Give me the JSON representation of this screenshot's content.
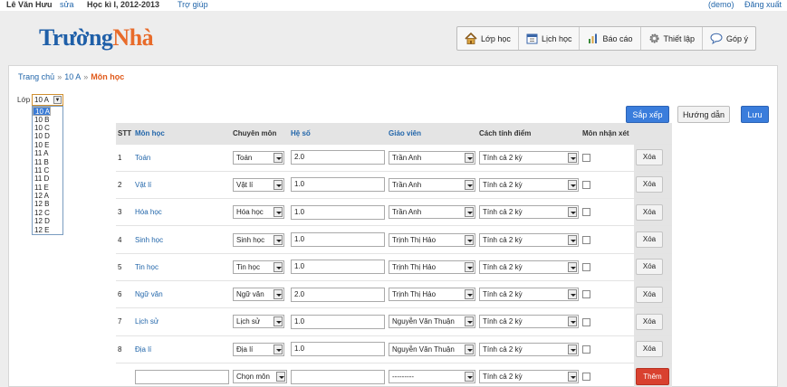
{
  "topbar": {
    "user": "Lê Văn Hưu",
    "edit": "sửa",
    "term": "Học kì I, 2012-2013",
    "help": "Trợ giúp",
    "demo": "(demo)",
    "logout": "Đăng xuất"
  },
  "logo": {
    "part1": "Trường",
    "part2": "Nhà"
  },
  "menu": [
    {
      "label": "Lớp học",
      "icon": "home-icon"
    },
    {
      "label": "Lịch học",
      "icon": "calendar-icon"
    },
    {
      "label": "Báo cáo",
      "icon": "bar-chart-icon"
    },
    {
      "label": "Thiết lập",
      "icon": "gear-icon"
    },
    {
      "label": "Góp ý",
      "icon": "speech-bubble-icon"
    }
  ],
  "breadcrumb": {
    "home": "Trang chủ",
    "class": "10 A",
    "current": "Môn học",
    "sep": "»"
  },
  "class_select": {
    "label": "Lớp",
    "value": "10 A",
    "options": [
      "10 A",
      "10 B",
      "10 C",
      "10 D",
      "10 E",
      "11 A",
      "11 B",
      "11 C",
      "11 D",
      "11 E",
      "12 A",
      "12 B",
      "12 C",
      "12 D",
      "12 E"
    ]
  },
  "buttons": {
    "sort": "Sắp xếp",
    "guide": "Hướng dẫn",
    "save": "Lưu"
  },
  "table": {
    "headers": [
      "STT",
      "Môn học",
      "Chuyên môn",
      "Hệ số",
      "Giáo viên",
      "Cách tính điểm",
      "Môn nhận xét"
    ],
    "rows": [
      {
        "stt": "1",
        "subject": "Toán",
        "spec": "Toán",
        "coef": "2.0",
        "teacher": "Trần Anh",
        "method": "Tính cả 2 kỳ",
        "delete": "Xóa"
      },
      {
        "stt": "2",
        "subject": "Vật lí",
        "spec": "Vật lí",
        "coef": "1.0",
        "teacher": "Trần Anh",
        "method": "Tính cả 2 kỳ",
        "delete": "Xóa"
      },
      {
        "stt": "3",
        "subject": "Hóa học",
        "spec": "Hóa học",
        "coef": "1.0",
        "teacher": "Trần Anh",
        "method": "Tính cả 2 kỳ",
        "delete": "Xóa"
      },
      {
        "stt": "4",
        "subject": "Sinh học",
        "spec": "Sinh học",
        "coef": "1.0",
        "teacher": "Trịnh Thị Hảo",
        "method": "Tính cả 2 kỳ",
        "delete": "Xóa"
      },
      {
        "stt": "5",
        "subject": "Tin học",
        "spec": "Tin học",
        "coef": "1.0",
        "teacher": "Trịnh Thị Hảo",
        "method": "Tính cả 2 kỳ",
        "delete": "Xóa"
      },
      {
        "stt": "6",
        "subject": "Ngữ văn",
        "spec": "Ngữ văn",
        "coef": "2.0",
        "teacher": "Trịnh Thị Hảo",
        "method": "Tính cả 2 kỳ",
        "delete": "Xóa"
      },
      {
        "stt": "7",
        "subject": "Lịch sử",
        "spec": "Lịch sử",
        "coef": "1.0",
        "teacher": "Nguyễn Văn Thuận",
        "method": "Tính cả 2 kỳ",
        "delete": "Xóa"
      },
      {
        "stt": "8",
        "subject": "Địa lí",
        "spec": "Địa lí",
        "coef": "1.0",
        "teacher": "Nguyễn Văn Thuận",
        "method": "Tính cả 2 kỳ",
        "delete": "Xóa"
      }
    ],
    "new_row": {
      "spec": "Chọn môn",
      "teacher": "---------",
      "method": "Tính cả 2 kỳ",
      "add": "Thêm"
    }
  }
}
